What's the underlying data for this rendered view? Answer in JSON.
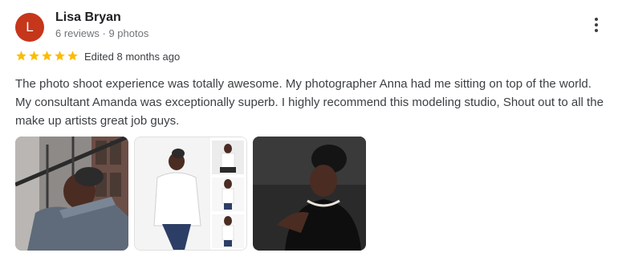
{
  "reviewer": {
    "avatar_letter": "L",
    "avatar_color": "#c5361b",
    "name": "Lisa Bryan",
    "meta": "6 reviews · 9 photos"
  },
  "rating": {
    "stars": 5,
    "out_of": 5,
    "star_color": "#fbbc04"
  },
  "edited": "Edited 8 months ago",
  "review_text": "The photo shoot experience was totally awesome. My photographer Anna had me sitting on top of the world. My consultant Amanda was exceptionally superb. I highly recommend this modeling studio, Shout out to all the make up artists great job guys.",
  "menu_icon": "more-vert-icon",
  "photos": [
    {
      "label": "review-photo-1"
    },
    {
      "label": "review-photo-2"
    },
    {
      "label": "review-photo-3"
    }
  ]
}
